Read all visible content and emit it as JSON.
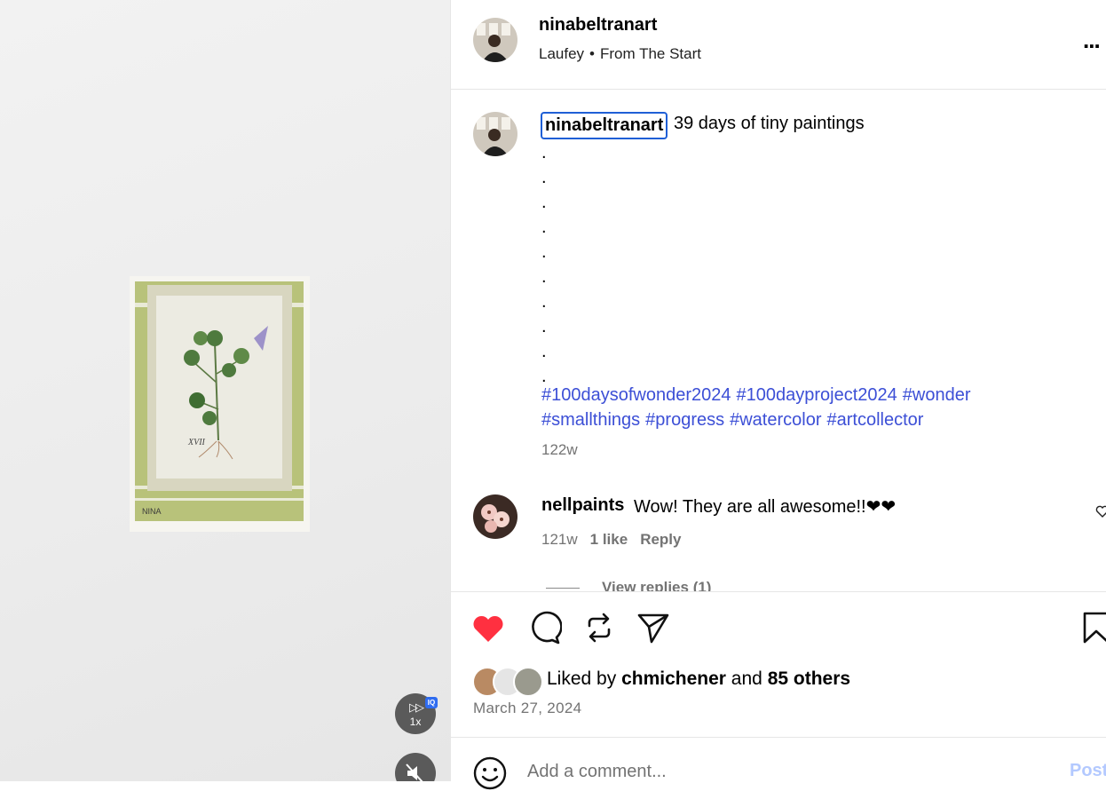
{
  "post": {
    "author": "ninabeltranart",
    "audio": {
      "artist": "Laufey",
      "separator": "•",
      "track": "From The Start"
    },
    "more_label": "..."
  },
  "caption": {
    "username": "ninabeltranart",
    "text": "39 days of tiny paintings",
    "dots": [
      ".",
      ".",
      ".",
      ".",
      ".",
      ".",
      ".",
      ".",
      ".",
      "."
    ],
    "hashtags": [
      "#100daysofwonder2024",
      "#100dayproject2024",
      "#wonder",
      "#smallthings",
      "#progress",
      "#watercolor",
      "#artcollector"
    ],
    "time": "122w"
  },
  "comment": {
    "username": "nellpaints",
    "text": "Wow! They are all awesome!!❤❤",
    "time": "121w",
    "likes": "1 like",
    "reply": "Reply",
    "view_replies": "View replies (1)"
  },
  "engagement": {
    "liked_by_prefix": "Liked by",
    "liked_by_user": "chmichener",
    "and": "and",
    "others": "85 others",
    "date": "March 27, 2024",
    "liked": true
  },
  "video": {
    "speed": "1x",
    "speed_badge": "IQ",
    "speed_glyph": "▷▷"
  },
  "artwork": {
    "signature": "NINA",
    "numeral": "XVII"
  },
  "add_comment": {
    "placeholder": "Add a comment...",
    "post_label": "Post"
  },
  "colors": {
    "link": "#3c4fd6",
    "heart": "#ff3040",
    "focus": "#1f5fd6",
    "post_disabled": "#b3c9ff"
  }
}
